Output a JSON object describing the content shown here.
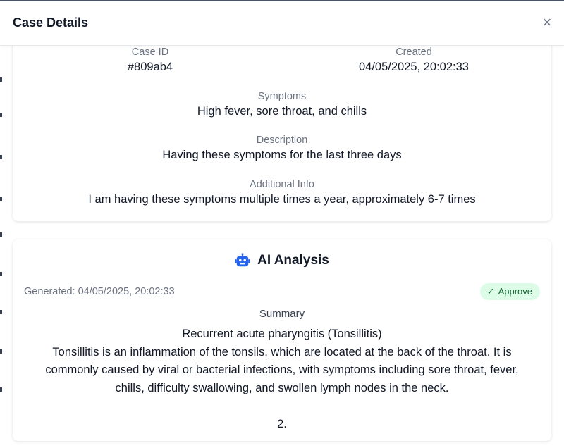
{
  "modal": {
    "title": "Case Details",
    "close_label": "×"
  },
  "case": {
    "id_label": "Case ID",
    "id_value": "#809ab4",
    "created_label": "Created",
    "created_value": "04/05/2025, 20:02:33",
    "symptoms_label": "Symptoms",
    "symptoms_value": "High fever, sore throat, and chills",
    "description_label": "Description",
    "description_value": "Having these symptoms for the last three days",
    "additional_label": "Additional Info",
    "additional_value": "I am having these symptoms multiple times a year, approximately 6-7 times"
  },
  "ai": {
    "title": "AI Analysis",
    "icon": "robot-icon",
    "generated": "Generated: 04/05/2025, 20:02:33",
    "approve_label": "Approve",
    "summary_label": "Summary",
    "summary_text": "Recurrent acute pharyngitis (Tonsillitis)\nTonsillitis is an inflammation of the tonsils, which are located at the back of the throat. It is commonly caused by viral or bacterial infections, with symptoms including sore throat, fever, chills, difficulty swallowing, and swollen lymph nodes in the neck.\n\n2."
  },
  "colors": {
    "accent": "#2563eb",
    "approve_bg": "#dcfce7",
    "approve_text": "#166534"
  }
}
